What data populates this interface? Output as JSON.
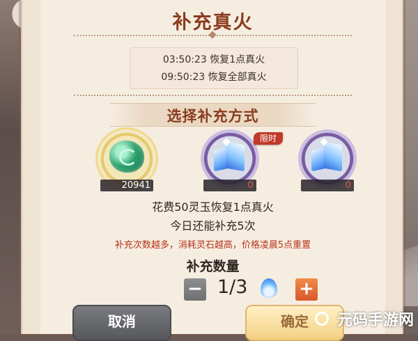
{
  "dialog": {
    "title": "补充真火",
    "timers": [
      "03:50:23 恢复1点真火",
      "09:50:23 恢复全部真火"
    ],
    "section_title": "选择补充方式",
    "options": [
      {
        "icon": "jade-icon",
        "count": "20941"
      },
      {
        "icon": "spirit-stone-icon",
        "count": "0",
        "badge": "限时"
      },
      {
        "icon": "spirit-stone-icon",
        "count": "0"
      }
    ],
    "cost_text": "花费50灵玉恢复1点真火",
    "remaining_text": "今日还能补充5次",
    "warning_text": "补充次数越多，消耗灵石越高，价格凌晨5点重置",
    "quantity_label": "补充数量",
    "minus_label": "−",
    "quantity_value": "1/3",
    "plus_label": "+",
    "cancel_label": "取消",
    "confirm_label": "确定"
  },
  "watermark": "元码手游网",
  "colors": {
    "title": "#8a3b1e",
    "warning": "#b53418",
    "plus_button": "#e0663a",
    "confirm_button": "#f4cf83"
  }
}
